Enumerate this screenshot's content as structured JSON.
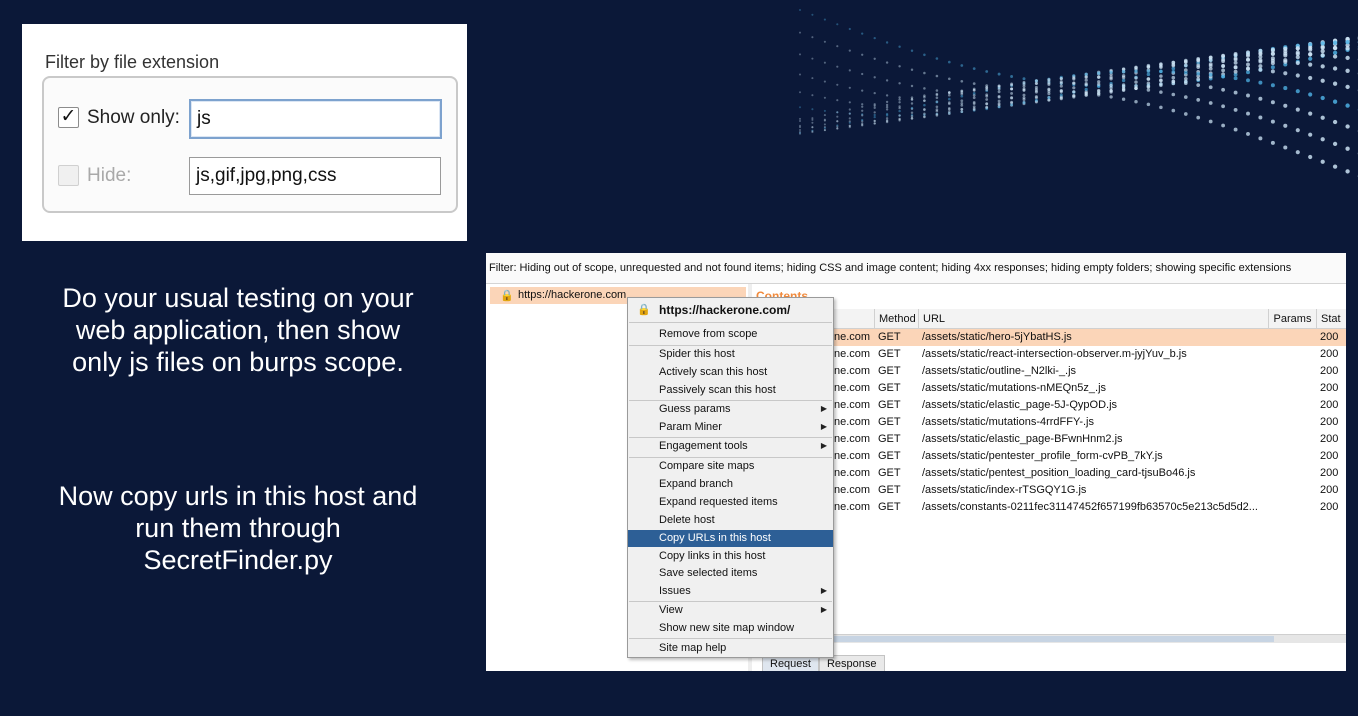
{
  "filter_panel": {
    "title": "Filter by file extension",
    "show_only": {
      "label": "Show only:",
      "checked_glyph": "✓",
      "value": "js"
    },
    "hide": {
      "label": "Hide:",
      "value": "js,gif,jpg,png,css"
    }
  },
  "captions": {
    "first": [
      "Do your usual testing on your",
      "web application, then show",
      "only js files on burps scope."
    ],
    "second": [
      "Now copy urls in this host and",
      "run them through",
      "SecretFinder.py"
    ]
  },
  "burp": {
    "filter_text": "Filter: Hiding out of scope, unrequested and not found items;  hiding CSS and image content;  hiding 4xx responses;  hiding empty folders;  showing specific extensions",
    "tree_host": "https://hackerone.com",
    "contents_tab": "Contents",
    "columns": {
      "method": "Method",
      "url": "URL",
      "params": "Params",
      "status": "Stat"
    },
    "rows": [
      {
        "host": "ne.com",
        "method": "GET",
        "url": "/assets/static/hero-5jYbatHS.js",
        "status": "200"
      },
      {
        "host": "ne.com",
        "method": "GET",
        "url": "/assets/static/react-intersection-observer.m-jyjYuv_b.js",
        "status": "200"
      },
      {
        "host": "ne.com",
        "method": "GET",
        "url": "/assets/static/outline-_N2lki-_.js",
        "status": "200"
      },
      {
        "host": "ne.com",
        "method": "GET",
        "url": "/assets/static/mutations-nMEQn5z_.js",
        "status": "200"
      },
      {
        "host": "ne.com",
        "method": "GET",
        "url": "/assets/static/elastic_page-5J-QypOD.js",
        "status": "200"
      },
      {
        "host": "ne.com",
        "method": "GET",
        "url": "/assets/static/mutations-4rrdFFY-.js",
        "status": "200"
      },
      {
        "host": "ne.com",
        "method": "GET",
        "url": "/assets/static/elastic_page-BFwnHnm2.js",
        "status": "200"
      },
      {
        "host": "ne.com",
        "method": "GET",
        "url": "/assets/static/pentester_profile_form-cvPB_7kY.js",
        "status": "200"
      },
      {
        "host": "ne.com",
        "method": "GET",
        "url": "/assets/static/pentest_position_loading_card-tjsuBo46.js",
        "status": "200"
      },
      {
        "host": "ne.com",
        "method": "GET",
        "url": "/assets/static/index-rTSGQY1G.js",
        "status": "200"
      },
      {
        "host": "ne.com",
        "method": "GET",
        "url": "/assets/constants-0211fec31147452f657199fb63570c5e213c5d5d2...",
        "status": "200"
      }
    ],
    "bottom_tabs": {
      "request": "Request",
      "response": "Response"
    }
  },
  "context_menu": {
    "header": "https://hackerone.com/",
    "items": [
      "Remove from scope",
      "Spider this host",
      "Actively scan this host",
      "Passively scan this host",
      "Guess params",
      "Param Miner",
      "Engagement tools",
      "Compare site maps",
      "Expand branch",
      "Expand requested items",
      "Delete host",
      "Copy URLs in this host",
      "Copy links in this host",
      "Save selected items",
      "Issues",
      "View",
      "Show new site map window",
      "Site map help"
    ],
    "highlighted": "Copy URLs in this host"
  }
}
